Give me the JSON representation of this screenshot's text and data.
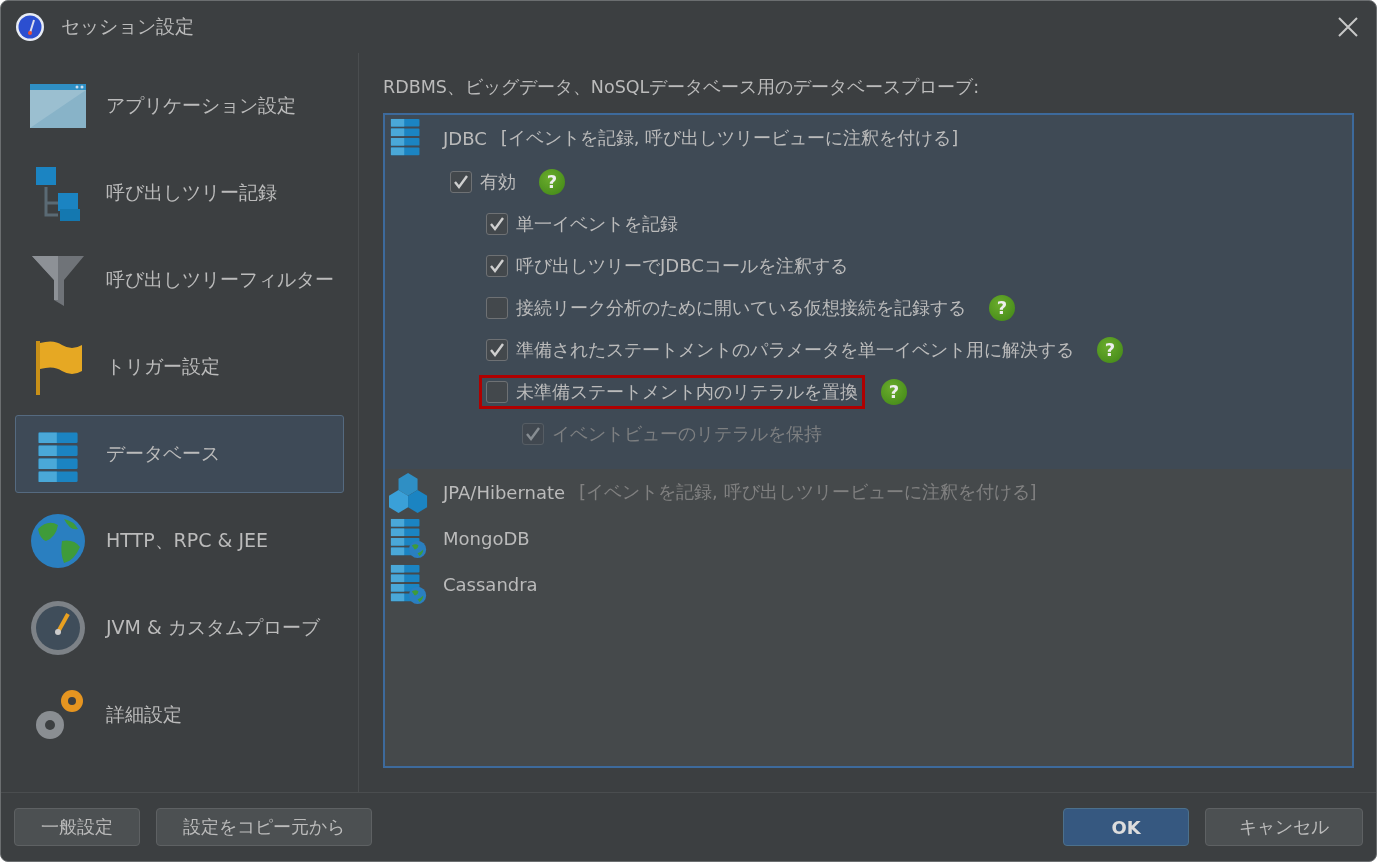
{
  "window": {
    "title": "セッション設定"
  },
  "sidebar": {
    "items": [
      {
        "kind": "window",
        "label": "アプリケーション設定",
        "selected": false
      },
      {
        "kind": "tree",
        "label": "呼び出しツリー記録",
        "selected": false
      },
      {
        "kind": "filter",
        "label": "呼び出しツリーフィルター",
        "selected": false
      },
      {
        "kind": "flag",
        "label": "トリガー設定",
        "selected": false
      },
      {
        "kind": "database",
        "label": "データベース",
        "selected": true
      },
      {
        "kind": "globe",
        "label": "HTTP、RPC & JEE",
        "selected": false
      },
      {
        "kind": "gauge",
        "label": "JVM & カスタムプローブ",
        "selected": false
      },
      {
        "kind": "gears",
        "label": "詳細設定",
        "selected": false
      }
    ]
  },
  "content": {
    "heading": "RDBMS、ビッグデータ、NoSQLデータベース用のデータベースプローブ:",
    "probes": [
      {
        "kind": "jdbc",
        "name": "JDBC",
        "detail": "[イベントを記録, 呼び出しツリービューに注釈を付ける]",
        "detail_dimmed": false,
        "selected": true,
        "options": [
          {
            "label": "有効",
            "checked": true,
            "disabled": false,
            "help": "?",
            "highlighted": false,
            "children": [
              {
                "label": "単一イベントを記録",
                "checked": true,
                "disabled": false,
                "highlighted": false
              },
              {
                "label": "呼び出しツリーでJDBCコールを注釈する",
                "checked": true,
                "disabled": false,
                "highlighted": false
              },
              {
                "label": "接続リーク分析のために開いている仮想接続を記録する",
                "checked": false,
                "disabled": false,
                "help": "?",
                "highlighted": false
              },
              {
                "label": "準備されたステートメントのパラメータを単一イベント用に解決する",
                "checked": true,
                "disabled": false,
                "help": "?",
                "highlighted": false
              },
              {
                "label": "未準備ステートメント内のリテラルを置換",
                "checked": false,
                "disabled": false,
                "help": "?",
                "highlighted": true,
                "children": [
                  {
                    "label": "イベントビューのリテラルを保持",
                    "checked": true,
                    "disabled": true,
                    "highlighted": false
                  }
                ]
              }
            ]
          }
        ]
      },
      {
        "kind": "jpa",
        "name": "JPA/Hibernate",
        "detail": "[イベントを記録, 呼び出しツリービューに注釈を付ける]",
        "detail_dimmed": true,
        "selected": false
      },
      {
        "kind": "nosql",
        "name": "MongoDB",
        "selected": false
      },
      {
        "kind": "nosql",
        "name": "Cassandra",
        "selected": false
      }
    ]
  },
  "footer": {
    "left_buttons": [
      "一般設定",
      "設定をコピー元から"
    ],
    "ok": "OK",
    "cancel": "キャンセル"
  }
}
